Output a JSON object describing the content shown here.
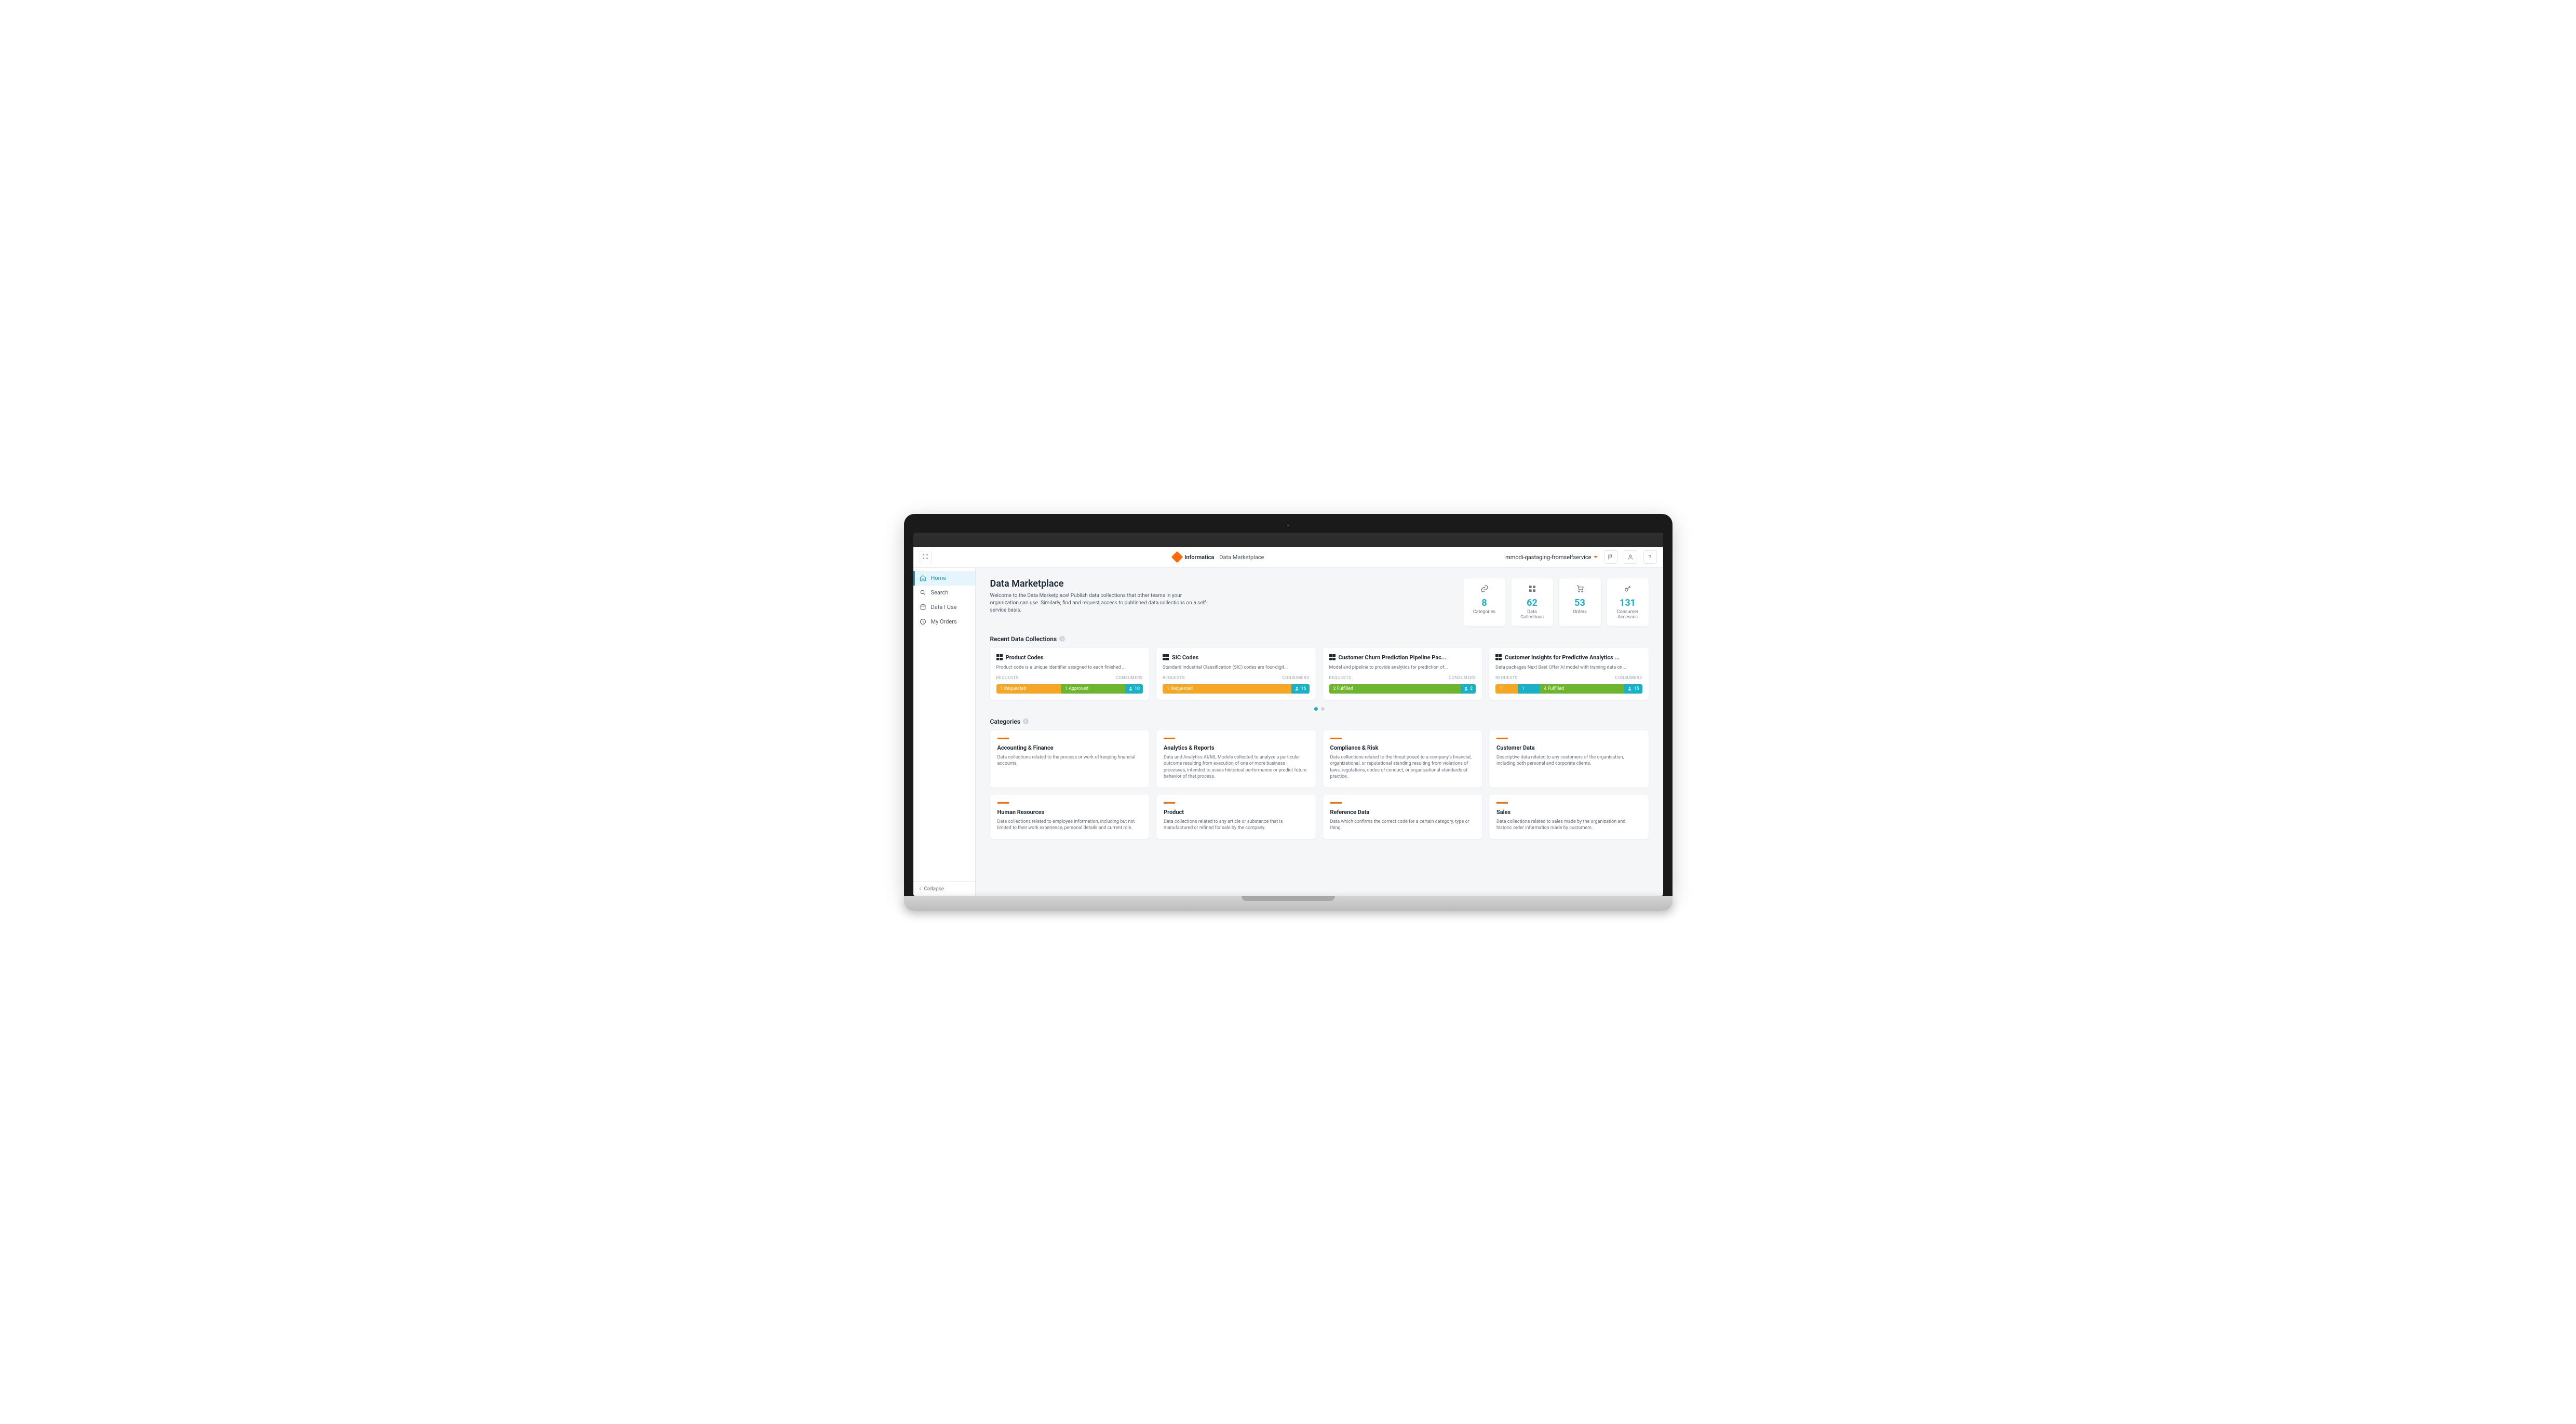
{
  "brand": {
    "name": "Informatica",
    "product": "Data Marketplace"
  },
  "org": "mmodi-qastaging-fromselfservice",
  "sidebar": {
    "items": [
      {
        "label": "Home",
        "icon": "home-icon",
        "active": true
      },
      {
        "label": "Search",
        "icon": "search-icon"
      },
      {
        "label": "Data I Use",
        "icon": "data-icon"
      },
      {
        "label": "My Orders",
        "icon": "orders-icon"
      }
    ],
    "collapse": "Collapse"
  },
  "page": {
    "title": "Data Marketplace",
    "description": "Welcome to the Data Marketplace! Publish data collections that other teams in your organization can use. Similarly, find and request access to published data collections on a self-service basis."
  },
  "stats": [
    {
      "value": "8",
      "label": "Categories",
      "icon": "link-icon"
    },
    {
      "value": "62",
      "label": "Data Collections",
      "icon": "grid-icon"
    },
    {
      "value": "53",
      "label": "Orders",
      "icon": "cart-icon"
    },
    {
      "value": "131",
      "label": "Consumer Accesses",
      "icon": "key-icon"
    }
  ],
  "sections": {
    "recent": "Recent Data Collections",
    "categories": "Categories"
  },
  "labels": {
    "requests": "REQUESTS",
    "consumers": "CONSUMERS"
  },
  "recent": [
    {
      "title": "Product Codes",
      "desc": "Product code is a unique identifier assigned to each finished ...",
      "segments": [
        {
          "text": "1 Requested",
          "class": "seg-orange",
          "flex": 3
        },
        {
          "text": "1 Approved",
          "class": "seg-green",
          "flex": 3
        }
      ],
      "consumers": "10"
    },
    {
      "title": "SIC Codes",
      "desc": "Standard Industrial Classification (SIC) codes are four-digit...",
      "segments": [
        {
          "text": "1 Requested",
          "class": "seg-orange",
          "flex": 6
        }
      ],
      "consumers": "16"
    },
    {
      "title": "Customer Churn Prediction Pipeline Pac...",
      "desc": "Model and pipeline to provide analytics for prediction of...",
      "segments": [
        {
          "text": "2 Fulfilled",
          "class": "seg-green",
          "flex": 6
        }
      ],
      "consumers": "2"
    },
    {
      "title": "Customer Insights for Predictive Analytics ...",
      "desc": "Data packages Next Best Offer AI model with training data on...",
      "segments": [
        {
          "text": "1",
          "class": "seg-orange",
          "flex": 0.8
        },
        {
          "text": "1",
          "class": "seg-teal",
          "flex": 0.8
        },
        {
          "text": "4 Fulfilled",
          "class": "seg-green",
          "flex": 4.4
        }
      ],
      "consumers": "15"
    }
  ],
  "categories": [
    {
      "title": "Accounting & Finance",
      "desc": "Data collections related to the process or work of keeping financial accounts."
    },
    {
      "title": "Analytics & Reports",
      "desc": "Data and Analytics AI/ML Models collected to analyze a particular outcome resulting from execution of one or more business processes, intended to asses historical performance or predict future behavior of that process."
    },
    {
      "title": "Compliance & Risk",
      "desc": "Data collections related to the threat posed to a company's financial, organizational, or reputational standing resulting from violations of laws, regulations, codes of conduct, or organizational standards of practice."
    },
    {
      "title": "Customer Data",
      "desc": "Descriptive data related to any customers of the organisation, including both personal and corporate clients."
    },
    {
      "title": "Human Resources",
      "desc": "Data collections related to employee information, including but not limited to their work experience, personal details and current role."
    },
    {
      "title": "Product",
      "desc": "Data collections related to any article or substance that is manufactured or refined for sale by the company."
    },
    {
      "title": "Reference Data",
      "desc": "Data which confirms the correct code for a certain category, type or thing."
    },
    {
      "title": "Sales",
      "desc": "Data collections related to sales made by the organization and historic order information made by customers."
    }
  ]
}
